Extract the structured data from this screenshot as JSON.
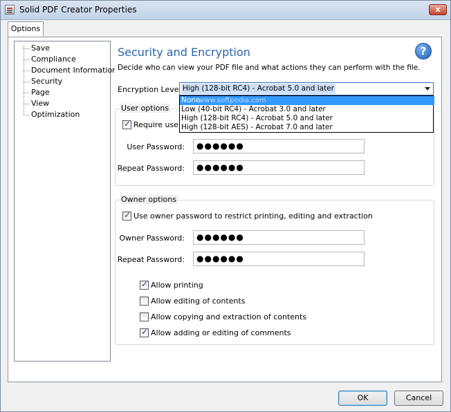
{
  "window": {
    "title": "Solid PDF Creator Properties",
    "close_label": "x"
  },
  "tabs": [
    {
      "label": "Options"
    }
  ],
  "tree": {
    "items": [
      "Save",
      "Compliance",
      "Document Information",
      "Security",
      "Page",
      "View",
      "Optimization"
    ]
  },
  "section": {
    "title": "Security and Encryption",
    "description": "Decide who can view your PDF file and what actions they can perform with the file.",
    "help_icon": "?"
  },
  "encryption": {
    "label": "Encryption Level:",
    "selected": "High (128-bit RC4) - Acrobat 5.0 and later",
    "options": [
      "None",
      "Low (40-bit RC4) - Acrobat 3.0 and later",
      "High (128-bit RC4) - Acrobat 5.0 and later",
      "High (128-bit AES) - Acrobat 7.0 and later"
    ],
    "highlighted_option": "None",
    "watermark": "www.softpedia.com"
  },
  "user_options": {
    "legend": "User options",
    "require_label": "Require user p",
    "require_checked": true,
    "user_password_label": "User Password:",
    "user_password_value": "●●●●●●",
    "repeat_password_label": "Repeat Password:",
    "repeat_password_value": "●●●●●●"
  },
  "owner_options": {
    "legend": "Owner options",
    "use_owner_label": "Use owner password to restrict printing, editing and extraction",
    "use_owner_checked": true,
    "owner_password_label": "Owner Password:",
    "owner_password_value": "●●●●●●",
    "repeat_password_label": "Repeat Password:",
    "repeat_password_value": "●●●●●●",
    "permissions": [
      {
        "label": "Allow printing",
        "checked": true
      },
      {
        "label": "Allow editing of contents",
        "checked": false
      },
      {
        "label": "Allow copying and extraction of contents",
        "checked": false
      },
      {
        "label": "Allow adding or editing of comments",
        "checked": true
      }
    ]
  },
  "buttons": {
    "ok": "OK",
    "cancel": "Cancel"
  }
}
